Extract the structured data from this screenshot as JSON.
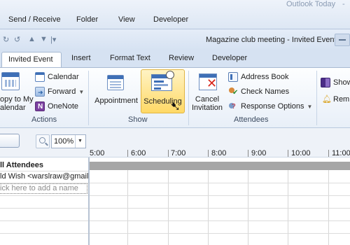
{
  "outer": {
    "title": "Outlook Today",
    "title_dash": "-",
    "tabs": [
      "Send / Receive",
      "Folder",
      "View",
      "Developer"
    ]
  },
  "window": {
    "title": "Magazine club meeting  -  Invited Event"
  },
  "ribbon_tabs": [
    "Invited Event",
    "Insert",
    "Format Text",
    "Review",
    "Developer"
  ],
  "groups": {
    "actions": {
      "label": "Actions",
      "copy_line1": "opy to My",
      "copy_line2": "alendar",
      "calendar": "Calendar",
      "forward": "Forward",
      "onenote": "OneNote"
    },
    "show": {
      "label": "Show",
      "appointment": "Appointment",
      "scheduling": "Scheduling"
    },
    "attendees": {
      "label": "Attendees",
      "cancel_line1": "Cancel",
      "cancel_line2": "Invitation",
      "address_book": "Address Book",
      "check_names": "Check Names",
      "response_options": "Response Options"
    },
    "partial": {
      "show_as": "Show",
      "reminder": "Rem"
    }
  },
  "scheduling": {
    "zoom": "100%",
    "times": [
      "5:00",
      "6:00",
      "7:00",
      "8:00",
      "9:00",
      "10:00",
      "11:00"
    ],
    "all_attendees": "ll Attendees",
    "attendee_1": "ld Wish <warslraw@gmail.c",
    "add_name_placeholder": "ick here to add a name"
  }
}
